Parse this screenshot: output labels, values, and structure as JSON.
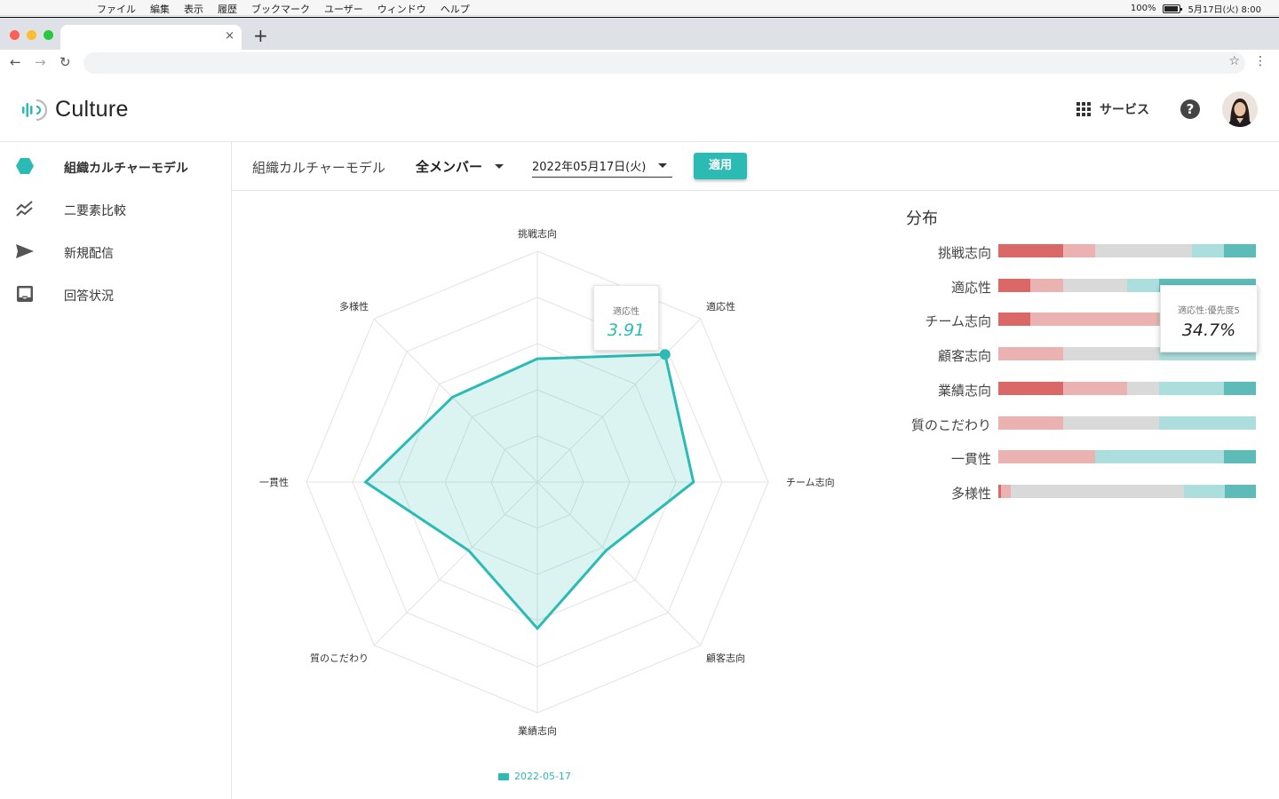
{
  "menubar": {
    "items": [
      "ファイル",
      "編集",
      "表示",
      "履歴",
      "ブックマーク",
      "ユーザー",
      "ウィンドウ",
      "ヘルプ"
    ],
    "battery": "100%",
    "datetime": "5月17日(火)  8:00"
  },
  "browser": {
    "tab_close": "×",
    "new_tab": "+",
    "back": "←",
    "forward": "→",
    "reload": "↻",
    "bookmark": "☆",
    "menu": "⋮"
  },
  "header": {
    "logo_text": "Culture",
    "service_label": "サービス",
    "help_label": "?"
  },
  "sidebar": {
    "items": [
      {
        "label": "組織カルチャーモデル",
        "icon": "hexagon-icon",
        "active": true
      },
      {
        "label": "二要素比較",
        "icon": "trend-lines-icon",
        "active": false
      },
      {
        "label": "新規配信",
        "icon": "send-icon",
        "active": false
      },
      {
        "label": "回答状況",
        "icon": "inbox-icon",
        "active": false
      }
    ]
  },
  "filter": {
    "title": "組織カルチャーモデル",
    "member": "全メンバー",
    "date": "2022年05月17日(火)",
    "apply": "適用"
  },
  "colors": {
    "accent": "#2bbbb4",
    "dist": [
      "#d96866",
      "#eab2b1",
      "#d9d9d9",
      "#acdedd",
      "#5ebcb8"
    ]
  },
  "chart_data": [
    {
      "type": "radar",
      "axes": [
        "挑戦志向",
        "適応性",
        "チーム志向",
        "顧客志向",
        "業績志向",
        "質のこだわり",
        "一貫性",
        "多様性"
      ],
      "rmax": 5,
      "series": [
        {
          "name": "2022-05-17",
          "values": [
            2.67,
            3.91,
            3.38,
            2.1,
            3.17,
            2.1,
            3.72,
            2.6
          ]
        }
      ],
      "tooltip": {
        "label": "適応性",
        "value": "3.91"
      }
    },
    {
      "type": "bar",
      "title": "分布",
      "stacked": true,
      "categories": [
        "挑戦志向",
        "適応性",
        "チーム志向",
        "顧客志向",
        "業績志向",
        "質のこだわり",
        "一貫性",
        "多様性"
      ],
      "series_values": [
        [
          25,
          12.5,
          37.5,
          12.5,
          12.5
        ],
        [
          12.5,
          12.5,
          25,
          12.5,
          37.5
        ],
        [
          12.5,
          50,
          0,
          37.5,
          0
        ],
        [
          0,
          25,
          37.5,
          37.5,
          0
        ],
        [
          25,
          25,
          12.5,
          25,
          12.5
        ],
        [
          0,
          25,
          37.5,
          37.5,
          0
        ],
        [
          0,
          37.5,
          0,
          50,
          12.5
        ],
        [
          1,
          4,
          67,
          16,
          12
        ]
      ],
      "tooltip": {
        "label": "適応性:優先度5",
        "value": "34.7%"
      }
    }
  ]
}
